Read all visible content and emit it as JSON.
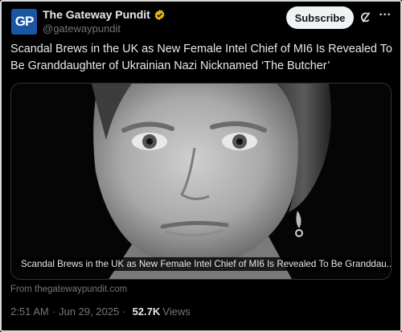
{
  "account": {
    "avatar_text": "GP",
    "display_name": "The Gateway Pundit",
    "handle": "@gatewaypundit",
    "verified_color": "#e2b719"
  },
  "actions": {
    "subscribe_label": "Subscribe",
    "more_label": "···"
  },
  "tweet": {
    "text": "Scandal Brews in the UK as New Female Intel Chief of MI6 Is Revealed To Be Granddaughter of Ukrainian Nazi Nicknamed ‘The Butcher’",
    "card_caption": "Scandal Brews in the UK as New Female Intel Chief of MI6 Is Revealed To Be Granddau...",
    "source": "From thegatewaypundit.com",
    "time": "2:51 AM",
    "separator": "·",
    "date": "Jun 29, 2025",
    "views_count": "52.7K",
    "views_label": "Views"
  },
  "colors": {
    "background": "#000000",
    "text_primary": "#e7e9ea",
    "text_secondary": "#71767b",
    "avatar_bg": "#1b56a4"
  },
  "icons": [
    "verified-badge-icon",
    "grok-icon",
    "more-icon"
  ]
}
